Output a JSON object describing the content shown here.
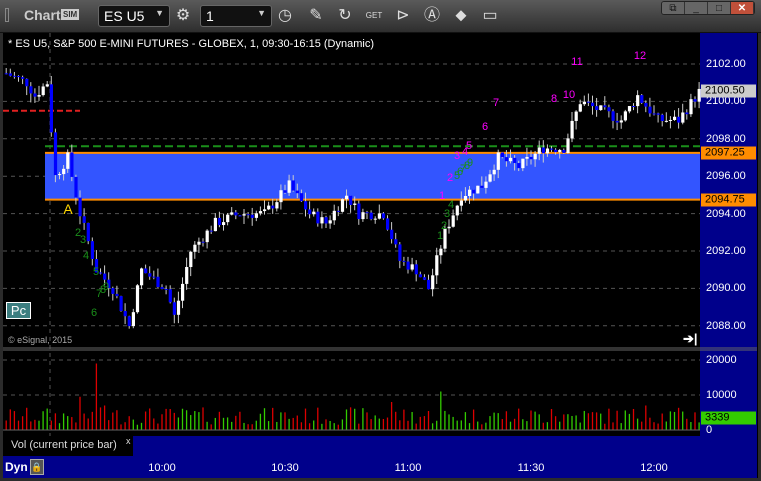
{
  "window": {
    "title": "Chart",
    "sim_badge": "SIM"
  },
  "toolbar": {
    "symbol": "ES U5",
    "interval": "1",
    "icons": [
      "settings-icon",
      "clock-icon",
      "pencil-icon",
      "refresh-icon",
      "get-icon",
      "play-icon",
      "autoscale-icon",
      "link-icon",
      "comment-icon"
    ]
  },
  "chart": {
    "header": "* ES U5, S&P 500 E-MINI FUTURES - GLOBEX, 1, 09:30-16:15 (Dynamic)",
    "copyright": "© eSignal, 2015",
    "pc_button": "Pc",
    "dyn_label": "Dyn",
    "price_labels": [
      "2102.00",
      "2100.00",
      "2098.00",
      "2096.00",
      "2094.00",
      "2092.00",
      "2090.00",
      "2088.00"
    ],
    "badges": {
      "last": "2100.50",
      "upper": "2097.25",
      "lower": "2094.75"
    },
    "levels": {
      "upper": 2097.25,
      "lower": 2094.75,
      "green_dashed": 2097.6,
      "red_dashed": 2099.5
    },
    "colors": {
      "up": "#ffffff",
      "down": "#0000ff",
      "band": "#3355ff",
      "level": "#ff8c00",
      "magenta": "#ff00ff",
      "green": "#1a8f1a"
    },
    "annotation_A": "A",
    "magenta_counts": [
      "1",
      "2",
      "3",
      "4",
      "5",
      "6",
      "7",
      "8",
      "10",
      "11",
      "12"
    ],
    "green_counts_left": [
      "2",
      "3",
      "4",
      "5",
      "7",
      "8",
      "9",
      "6"
    ],
    "green_counts_right": [
      "1",
      "2",
      "3",
      "4",
      "5",
      "6",
      "7",
      "8",
      "9"
    ]
  },
  "chart_data": {
    "type": "candlestick",
    "x_unit": "minutes from 10:00",
    "ylim": [
      2087.3,
      2103
    ],
    "path": [
      [
        -38,
        2101.5
      ],
      [
        -33,
        2101
      ],
      [
        -31,
        2100.3
      ],
      [
        -28,
        2101
      ],
      [
        -26,
        2096
      ],
      [
        -23,
        2097
      ],
      [
        -20,
        2094
      ],
      [
        -16,
        2091
      ],
      [
        -12,
        2090
      ],
      [
        -8,
        2088
      ],
      [
        -5,
        2091
      ],
      [
        1,
        2090
      ],
      [
        3,
        2088.5
      ],
      [
        7,
        2092
      ],
      [
        13,
        2093.5
      ],
      [
        19,
        2094
      ],
      [
        25,
        2094
      ],
      [
        31,
        2095.5
      ],
      [
        36,
        2094
      ],
      [
        40,
        2093.5
      ],
      [
        45,
        2095
      ],
      [
        48,
        2094
      ],
      [
        54,
        2094
      ],
      [
        58,
        2091.5
      ],
      [
        62,
        2091
      ],
      [
        65,
        2090
      ],
      [
        69,
        2093
      ],
      [
        73,
        2095
      ],
      [
        78,
        2095.5
      ],
      [
        82,
        2097
      ],
      [
        87,
        2096.5
      ],
      [
        93,
        2097.5
      ],
      [
        98,
        2097.5
      ],
      [
        102,
        2100
      ],
      [
        107,
        2099.5
      ],
      [
        112,
        2099
      ],
      [
        116,
        2100.3
      ],
      [
        121,
        2099
      ],
      [
        126,
        2099
      ],
      [
        131,
        2100.5
      ]
    ],
    "time_labels": [
      "10:00",
      "10:30",
      "11:00",
      "11:30",
      "12:00"
    ],
    "volume": {
      "label": "Vol (current price bar)",
      "close_label": "x",
      "axis": [
        "20000",
        "10000",
        "0"
      ],
      "current": "3339",
      "ylim": [
        0,
        20000
      ],
      "spikes": [
        [
          -16,
          19000
        ],
        [
          -20,
          9500
        ],
        [
          -14,
          7000
        ],
        [
          56,
          8000
        ],
        [
          68,
          11000
        ],
        [
          95,
          6000
        ],
        [
          118,
          7000
        ]
      ]
    }
  }
}
